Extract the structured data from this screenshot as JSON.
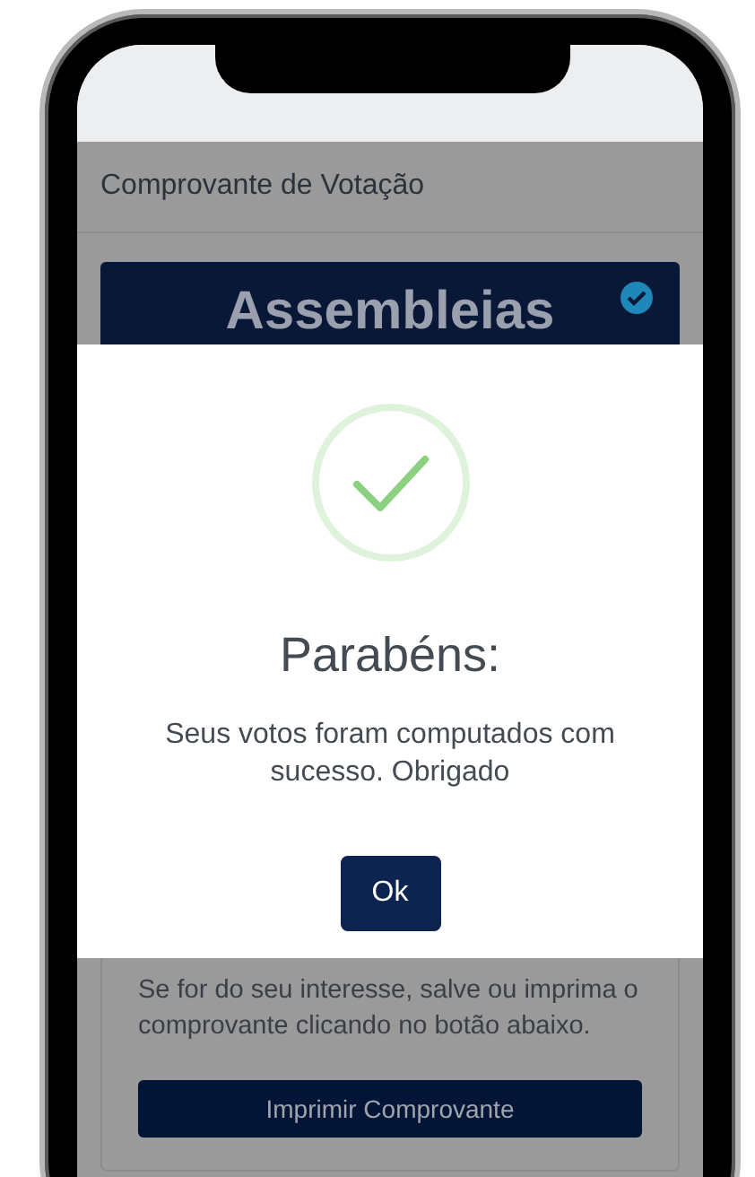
{
  "header": {
    "title": "Comprovante de Votação"
  },
  "banner": {
    "logo_text": "Assembleias"
  },
  "dialog": {
    "title": "Parabéns:",
    "message": "Seus votos foram computados com sucesso. Obrigado",
    "button": "Ok"
  },
  "card": {
    "text": "Se for do seu interesse, salve ou imprima o comprovante clicando no botão abaixo.",
    "button": "Imprimir Comprovante"
  }
}
